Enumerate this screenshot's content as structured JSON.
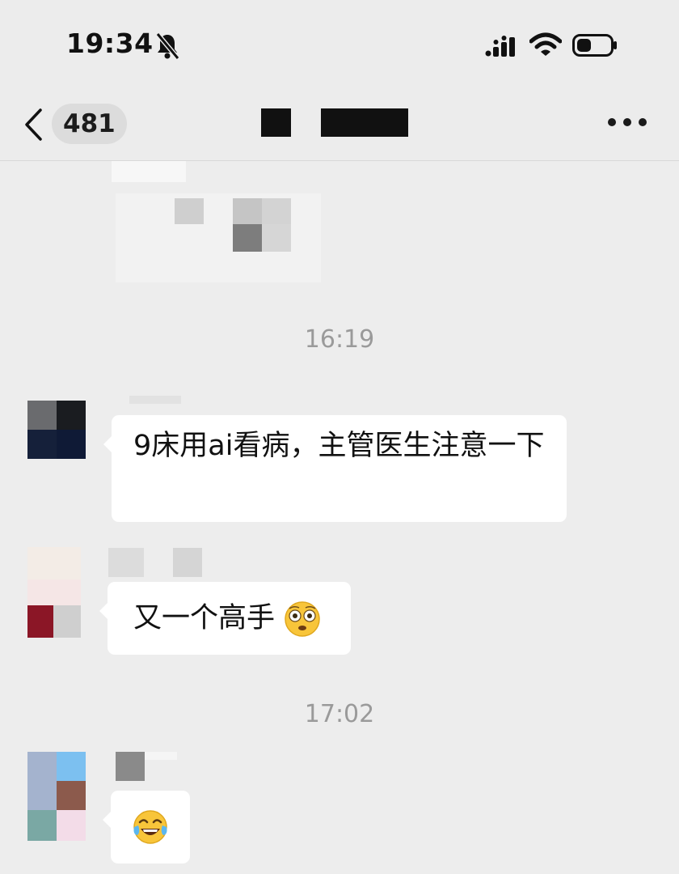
{
  "status_bar": {
    "time": "19:34",
    "icons": [
      "bell-slash-icon",
      "signal-icon",
      "wifi-icon",
      "battery-icon"
    ]
  },
  "nav": {
    "back_icon": "chevron-left-icon",
    "unread_count": "481",
    "more_icon": "more-dots-icon"
  },
  "timestamps": [
    "16:19",
    "17:02"
  ],
  "messages": [
    {
      "text": "9床用ai看病，主管医生注意一下"
    },
    {
      "text": "又一个高手",
      "emoji": "flushed-face-emoji"
    },
    {
      "emoji": "tears-of-joy-emoji"
    }
  ],
  "colors": {
    "background": "#ededed",
    "bubble": "#ffffff",
    "timestamp": "#9a9a9a"
  }
}
